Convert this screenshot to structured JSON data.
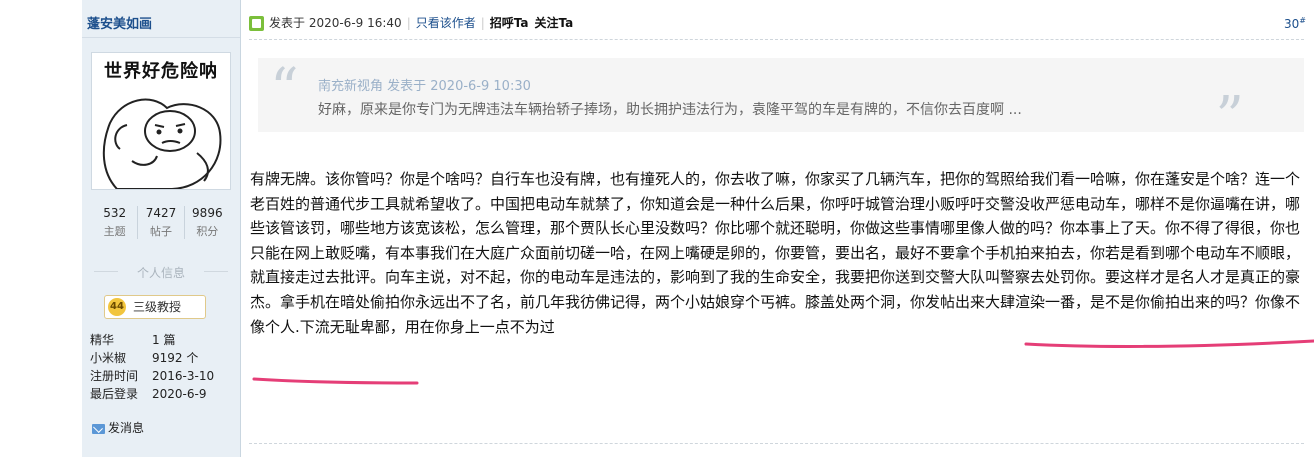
{
  "colors": {
    "sidebar_bg": "#e8eff5",
    "link": "#1c4f8c",
    "annotation_ink": "#e53e77"
  },
  "author": {
    "name": "蓬安美如画",
    "avatar_text": "世界好危险呐",
    "stats": [
      {
        "value": "532",
        "label": "主题"
      },
      {
        "value": "7427",
        "label": "帖子"
      },
      {
        "value": "9896",
        "label": "积分"
      }
    ],
    "section_title": "个人信息",
    "rank": {
      "badge": "44",
      "label": "三级教授"
    },
    "profile": [
      {
        "key": "精华",
        "value": "1 篇"
      },
      {
        "key": "小米椒",
        "value": "9192 个"
      },
      {
        "key": "注册时间",
        "value": "2016-3-10"
      },
      {
        "key": "最后登录",
        "value": "2020-6-9"
      }
    ],
    "message_label": "发消息"
  },
  "post": {
    "posted": "发表于 2020-6-9 16:40",
    "only_author": "只看该作者",
    "greet": "招呼Ta",
    "follow": "关注Ta",
    "floor": "30",
    "floor_mark": "#",
    "quote": {
      "meta": "南充新视角 发表于 2020-6-9 10:30",
      "text": "好麻，原来是你专门为无牌违法车辆抬轿子捧场，助长拥护违法行为，袁隆平驾的车是有牌的，不信你去百度啊 ..."
    },
    "content_main": "有牌无牌。该你管吗？你是个啥吗？自行车也没有牌，也有撞死人的，你去收了嘛，你家买了几辆汽车，把你的驾照给我们看一哈嘛，你在蓬安是个啥？连一个老百姓的普通代步工具就希望收了。中国把电动车就禁了，你知道会是一种什么后果，你呼吁城管治理小贩呼吁交警没收严惩电动车，哪样不是你逼嘴在讲，哪些该管该罚，哪些地方该宽该松，怎么管理，那个贾队长心里没数吗？你比哪个就还聪明，你做这些事情哪里像人做的吗？你本事上了天。你不得了得很，你也只能在网上敢贬嘴，有本事我们在大庭广众面前切磋一哈，在网上嘴硬是卵的，你要管，要出名，最好不要拿个手机拍来拍去，你若是看到哪个电动车不顺眼，就直接走过去批评。向车主说，对不起，你的电动车是违法的，影响到了我的生命安全，我要把你送到交警大队叫警察去处罚你。要这样才是名人才是真正的豪杰。拿手机在暗处偷拍你永远出不了名，前几年我彷佛记得，两个小姑娘穿个丐裤。膝盖处两个洞，你发帖出来大肆渲染一番，是不是你偷拍出来的吗？",
    "content_highlight": "你像不像个人.下流无耻卑鄙，用在你身上一点不为过"
  }
}
